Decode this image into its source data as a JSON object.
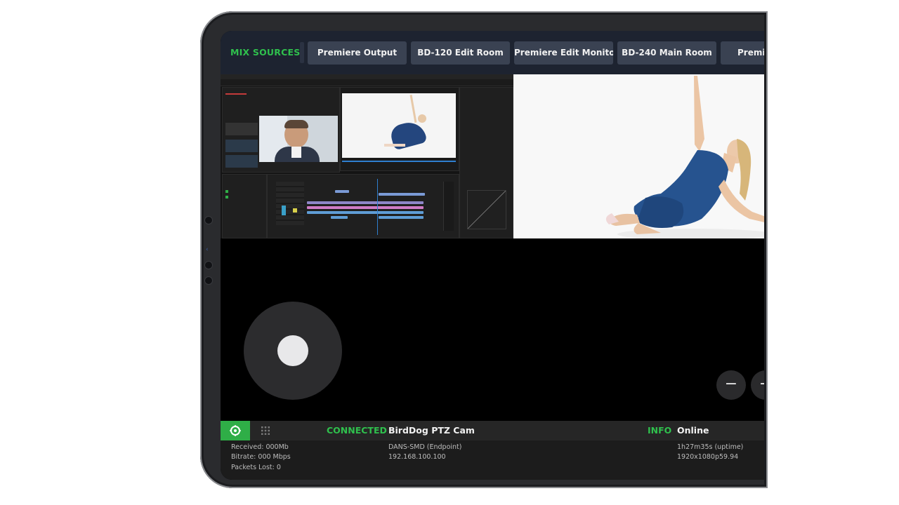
{
  "mix_bar": {
    "label": "MIX SOURCES:",
    "sources": [
      "Premiere Output",
      "BD-120 Edit Room",
      "Premiere Edit Monitor",
      "BD-240 Main Room",
      "Premiere"
    ]
  },
  "joystick": {
    "icon": "joystick-icon"
  },
  "zoom": {
    "out_label": "−",
    "in_label": "+"
  },
  "status": {
    "connected_label": "CONNECTED",
    "device_name": "BirdDog PTZ Cam",
    "info_label": "INFO",
    "info_value": "Online",
    "received": "Received: 000Mb",
    "bitrate": "Bitrate: 000 Mbps",
    "packets_lost": "Packets Lost: 0",
    "endpoint": "DANS-SMD (Endpoint)",
    "ip": "192.168.100.100",
    "uptime": "1h27m35s (uptime)",
    "resolution": "1920x1080p59.94"
  },
  "colors": {
    "accent_green": "#2fc04d",
    "bar_bg": "#1d2330",
    "source_button": "#3a4252"
  }
}
